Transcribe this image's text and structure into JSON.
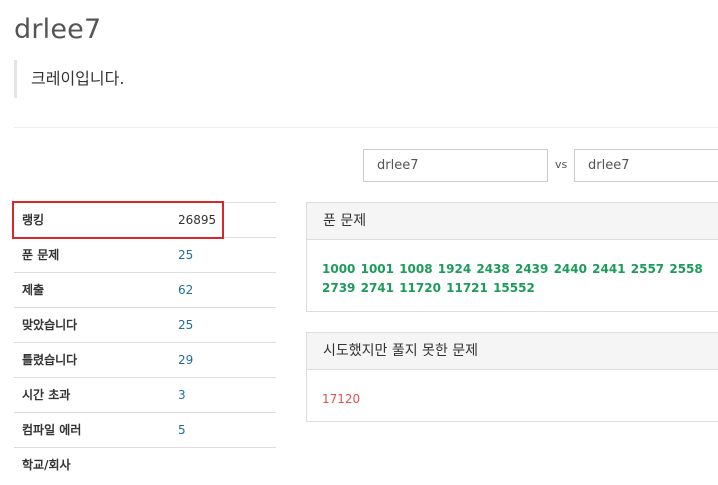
{
  "profile": {
    "username": "drlee7",
    "bio": "크레이입니다."
  },
  "compare": {
    "left_user": "drlee7",
    "vs_label": "vs",
    "right_user": "drlee7"
  },
  "stats": [
    {
      "label": "랭킹",
      "value": "26895"
    },
    {
      "label": "푼 문제",
      "value": "25"
    },
    {
      "label": "제출",
      "value": "62"
    },
    {
      "label": "맞았습니다",
      "value": "25"
    },
    {
      "label": "틀렸습니다",
      "value": "29"
    },
    {
      "label": "시간 초과",
      "value": "3"
    },
    {
      "label": "컴파일 에러",
      "value": "5"
    },
    {
      "label": "학교/회사",
      "value": ""
    }
  ],
  "solved_panel": {
    "title": "푼 문제",
    "problems": [
      "1000",
      "1001",
      "1008",
      "1924",
      "2438",
      "2439",
      "2440",
      "2441",
      "2557",
      "2558",
      "2739",
      "2741",
      "11720",
      "11721",
      "15552"
    ]
  },
  "failed_panel": {
    "title": "시도했지만 풀지 못한 문제",
    "problems": [
      "17120"
    ]
  },
  "colors": {
    "highlight": "#d9272d",
    "solved_link": "#1c9b5b",
    "failed_link": "#d9534f",
    "stat_link": "#1e6fa0"
  }
}
